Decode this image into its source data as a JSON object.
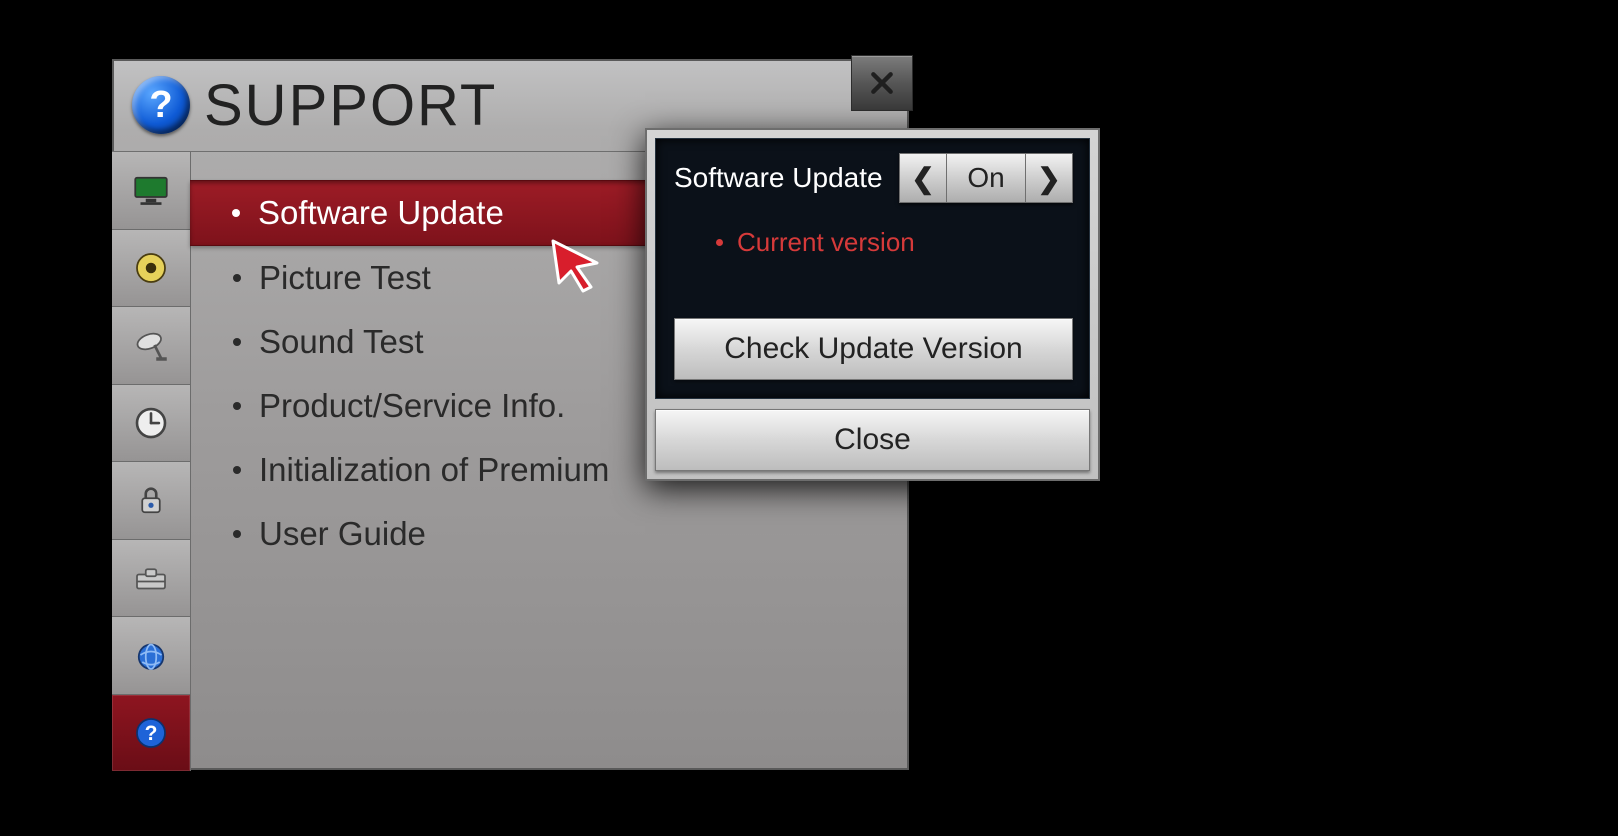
{
  "window": {
    "title": "SUPPORT"
  },
  "sidebar_icons": [
    {
      "name": "picture-icon"
    },
    {
      "name": "sound-icon"
    },
    {
      "name": "channel-icon"
    },
    {
      "name": "time-icon"
    },
    {
      "name": "lock-icon"
    },
    {
      "name": "option-icon"
    },
    {
      "name": "network-icon"
    },
    {
      "name": "support-icon"
    }
  ],
  "menu": {
    "items": [
      {
        "label": "Software Update",
        "active": true
      },
      {
        "label": "Picture Test"
      },
      {
        "label": "Sound Test"
      },
      {
        "label": "Product/Service Info."
      },
      {
        "label": "Initialization of Premium"
      },
      {
        "label": "User Guide"
      }
    ]
  },
  "popup": {
    "title": "Software Update",
    "toggle_value": "On",
    "current_version_label": "Current version",
    "check_button": "Check Update Version",
    "close_button": "Close"
  },
  "colors": {
    "accent_red": "#8e1520",
    "highlight_red_text": "#d63a3a",
    "panel_grey": "#9e9c9c",
    "popup_dark": "#0b1119"
  }
}
